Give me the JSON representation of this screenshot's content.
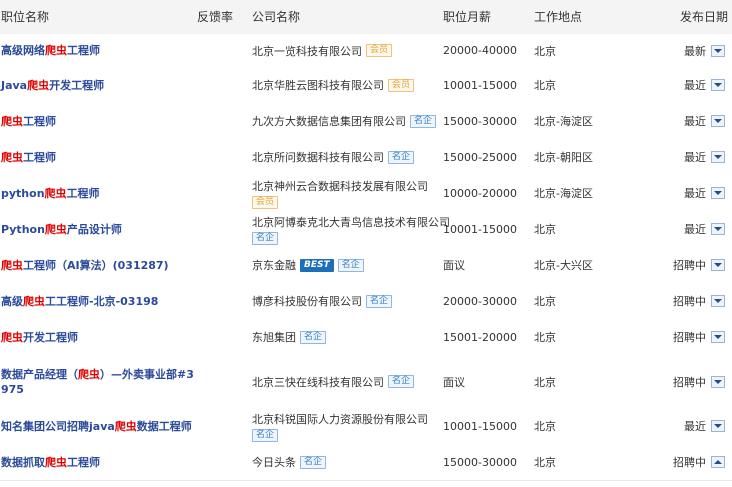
{
  "headers": {
    "title": "职位名称",
    "feedback_rate": "反馈率",
    "company": "公司名称",
    "salary": "职位月薪",
    "location": "工作地点",
    "date": "发布日期"
  },
  "badges": {
    "member": "会员",
    "famous": "名企",
    "best": "BEST"
  },
  "rows": [
    {
      "title_parts": [
        [
          "高级网络",
          false
        ],
        [
          "爬虫",
          true
        ],
        [
          "工程师",
          false
        ]
      ],
      "company": "北京一览科技有限公司",
      "company_line2": "",
      "badges": [
        "member"
      ],
      "salary": "20000-40000",
      "location": "北京",
      "date": "最新",
      "toggle": "down"
    },
    {
      "title_parts": [
        [
          "Java",
          false
        ],
        [
          "爬虫",
          true
        ],
        [
          "开发工程师",
          false
        ]
      ],
      "company": "北京华胜云图科技有限公司",
      "company_line2": "",
      "badges": [
        "member"
      ],
      "salary": "10001-15000",
      "location": "北京",
      "date": "最近",
      "toggle": "down"
    },
    {
      "title_parts": [
        [
          "爬虫",
          true
        ],
        [
          "工程师",
          false
        ]
      ],
      "company": "九次方大数据信息集团有限公司",
      "company_line2": "",
      "badges": [
        "famous"
      ],
      "salary": "15000-30000",
      "location": "北京-海淀区",
      "date": "最近",
      "toggle": "down"
    },
    {
      "title_parts": [
        [
          "爬虫",
          true
        ],
        [
          "工程师",
          false
        ]
      ],
      "company": "北京所问数据科技有限公司",
      "company_line2": "",
      "badges": [
        "famous"
      ],
      "salary": "15000-25000",
      "location": "北京-朝阳区",
      "date": "最近",
      "toggle": "down"
    },
    {
      "title_parts": [
        [
          "python",
          false
        ],
        [
          "爬虫",
          true
        ],
        [
          "工程师",
          false
        ]
      ],
      "company": "北京神州云合数据科技发展有限公司",
      "company_line2": "badges",
      "badges": [
        "member"
      ],
      "salary": "10000-20000",
      "location": "北京-海淀区",
      "date": "最近",
      "toggle": "down"
    },
    {
      "title_parts": [
        [
          "Python",
          false
        ],
        [
          "爬虫",
          true
        ],
        [
          "产品设计师",
          false
        ]
      ],
      "company": "北京阿博泰克北大青鸟信息技术有限公司",
      "company_line2": "badges",
      "badges": [
        "famous"
      ],
      "salary": "10001-15000",
      "location": "北京",
      "date": "最近",
      "toggle": "down"
    },
    {
      "title_parts": [
        [
          "爬虫",
          true
        ],
        [
          "工程师（AI算法）(031287)",
          false
        ]
      ],
      "company": "京东金融",
      "company_line2": "",
      "badges": [
        "best",
        "famous"
      ],
      "salary": "面议",
      "location": "北京-大兴区",
      "date": "招聘中",
      "toggle": "down"
    },
    {
      "title_parts": [
        [
          "高级",
          false
        ],
        [
          "爬虫",
          true
        ],
        [
          "工工程师-北京-03198",
          false
        ]
      ],
      "company": "博彦科技股份有限公司",
      "company_line2": "",
      "badges": [
        "famous"
      ],
      "salary": "20000-30000",
      "location": "北京",
      "date": "招聘中",
      "toggle": "down"
    },
    {
      "title_parts": [
        [
          "爬虫",
          true
        ],
        [
          "开发工程师",
          false
        ]
      ],
      "company": "东旭集团",
      "company_line2": "",
      "badges": [
        "famous"
      ],
      "salary": "15001-20000",
      "location": "北京",
      "date": "招聘中",
      "toggle": "down"
    },
    {
      "title_parts": [
        [
          "数据产品经理（",
          false
        ],
        [
          "爬虫",
          true
        ],
        [
          "）—外卖事业部#3975",
          false
        ]
      ],
      "company": "北京三快在线科技有限公司",
      "company_line2": "",
      "badges": [
        "famous"
      ],
      "salary": "面议",
      "location": "北京",
      "date": "招聘中",
      "toggle": "down"
    },
    {
      "title_parts": [
        [
          "知名集团公司招聘java",
          false
        ],
        [
          "爬虫",
          true
        ],
        [
          "数据工程师",
          false
        ]
      ],
      "company": "北京科锐国际人力资源股份有限公司",
      "company_line2": "badges",
      "badges": [
        "famous"
      ],
      "salary": "10001-15000",
      "location": "北京",
      "date": "最近",
      "toggle": "down"
    },
    {
      "title_parts": [
        [
          "数据抓取",
          false
        ],
        [
          "爬虫",
          true
        ],
        [
          "工程师",
          false
        ]
      ],
      "company": "今日头条",
      "company_line2": "",
      "badges": [
        "famous"
      ],
      "salary": "15000-30000",
      "location": "北京",
      "date": "招聘中",
      "toggle": "up"
    }
  ]
}
